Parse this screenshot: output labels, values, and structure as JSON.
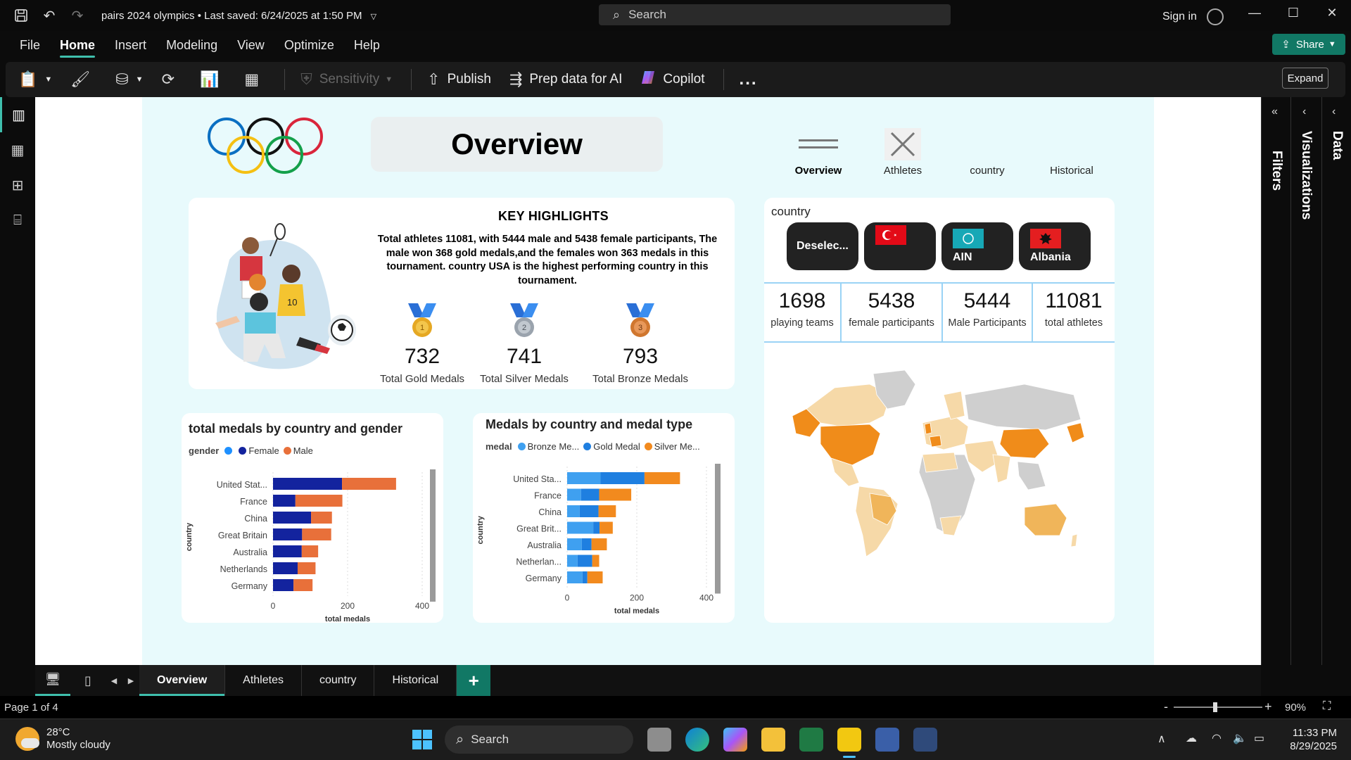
{
  "titlebar": {
    "doc_title": "pairs 2024 olympics",
    "saved_status": "Last saved: 6/24/2025 at 1:50 PM",
    "search_placeholder": "Search",
    "sign_in": "Sign in",
    "expand_tooltip": "Expand"
  },
  "menu": [
    "File",
    "Home",
    "Insert",
    "Modeling",
    "View",
    "Optimize",
    "Help"
  ],
  "share_label": "Share",
  "ribbon": {
    "sensitivity": "Sensitivity",
    "publish": "Publish",
    "prep_data": "Prep data for AI",
    "copilot": "Copilot",
    "more": "..."
  },
  "report": {
    "title": "Overview",
    "nav": [
      {
        "label": "Overview"
      },
      {
        "label": "Athletes"
      },
      {
        "label": "country"
      },
      {
        "label": "Historical"
      }
    ],
    "key_highlights": {
      "title": "KEY HIGHLIGHTS",
      "text": "Total athletes 11081, with 5444 male and 5438 female participants, The male won 368 gold medals,and the females won 363 medals in this tournament. country USA is the highest performing country in this tournament.",
      "medals": [
        {
          "value": "732",
          "label": "Total Gold Medals",
          "color": "#e5a823",
          "num": "1"
        },
        {
          "value": "741",
          "label": "Total Silver Medals",
          "color": "#9aa3ad",
          "num": "2"
        },
        {
          "value": "793",
          "label": "Total Bronze Medals",
          "color": "#d0772f",
          "num": "3"
        }
      ]
    },
    "country_slicer": {
      "header": "country",
      "chips": [
        {
          "label": "Deselec..."
        },
        {
          "label": ""
        },
        {
          "label": "AIN"
        },
        {
          "label": "Albania"
        }
      ]
    },
    "stats": [
      {
        "value": "1698",
        "label": "playing teams"
      },
      {
        "value": "5438",
        "label": "female participants"
      },
      {
        "value": "5444",
        "label": "Male Participants"
      },
      {
        "value": "11081",
        "label": "total athletes"
      }
    ]
  },
  "chart_data": [
    {
      "type": "bar",
      "orientation": "horizontal",
      "stacked": true,
      "title": "total medals by country and gender",
      "legend_title": "gender",
      "legend": [
        "",
        "Female",
        "Male"
      ],
      "legend_colors": [
        "#1e90ff",
        "#13239e",
        "#e8703a"
      ],
      "categories": [
        "United Stat...",
        "France",
        "China",
        "Great Britain",
        "Australia",
        "Netherlands",
        "Germany"
      ],
      "series": [
        {
          "name": "Female",
          "color": "#13239e",
          "values": [
            185,
            60,
            102,
            78,
            77,
            66,
            55
          ]
        },
        {
          "name": "Male",
          "color": "#e8703a",
          "values": [
            145,
            126,
            56,
            78,
            44,
            48,
            51
          ]
        }
      ],
      "xlabel": "total medals",
      "ylabel": "country",
      "xticks": [
        0,
        200,
        400
      ],
      "xlim": [
        0,
        400
      ]
    },
    {
      "type": "bar",
      "orientation": "horizontal",
      "stacked": true,
      "title": "Medals by country and medal type",
      "legend_title": "medal",
      "legend": [
        "Bronze Me...",
        "Gold Medal",
        "Silver Me..."
      ],
      "legend_colors": [
        "#3fa0f0",
        "#1f7fe0",
        "#f28a1e"
      ],
      "categories": [
        "United Sta...",
        "France",
        "China",
        "Great Brit...",
        "Australia",
        "Netherlan...",
        "Germany"
      ],
      "series": [
        {
          "name": "Bronze Medal",
          "color": "#3fa0f0",
          "values": [
            96,
            40,
            36,
            75,
            42,
            30,
            44
          ]
        },
        {
          "name": "Gold Medal",
          "color": "#1f7fe0",
          "values": [
            126,
            52,
            54,
            18,
            28,
            42,
            14
          ]
        },
        {
          "name": "Silver Medal",
          "color": "#f28a1e",
          "values": [
            102,
            92,
            50,
            38,
            44,
            20,
            44
          ]
        }
      ],
      "xlabel": "total medals",
      "ylabel": "country",
      "xticks": [
        0,
        200,
        400
      ],
      "xlim": [
        0,
        400
      ]
    }
  ],
  "page_tabs": [
    "Overview",
    "Athletes",
    "country",
    "Historical"
  ],
  "right_panes": [
    "Filters",
    "Visualizations",
    "Data"
  ],
  "status": {
    "page": "Page 1 of 4",
    "zoom": "90%"
  },
  "taskbar": {
    "temp": "28°C",
    "weather": "Mostly cloudy",
    "search": "Search",
    "time": "11:33 PM",
    "date": "8/29/2025"
  }
}
